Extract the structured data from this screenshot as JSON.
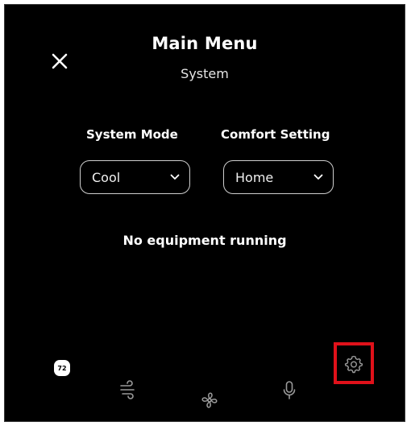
{
  "header": {
    "title": "Main Menu",
    "subtitle": "System"
  },
  "settings": {
    "system_mode_label": "System Mode",
    "system_mode_value": "Cool",
    "comfort_setting_label": "Comfort Setting",
    "comfort_setting_value": "Home"
  },
  "status": {
    "text": "No equipment running"
  },
  "bottom_nav": {
    "temperature_badge": "72",
    "icons": [
      "airflow-icon",
      "fan-icon",
      "microphone-icon",
      "gear-icon"
    ]
  },
  "colors": {
    "background": "#000000",
    "text": "#ffffff",
    "highlight": "#e0111a"
  }
}
